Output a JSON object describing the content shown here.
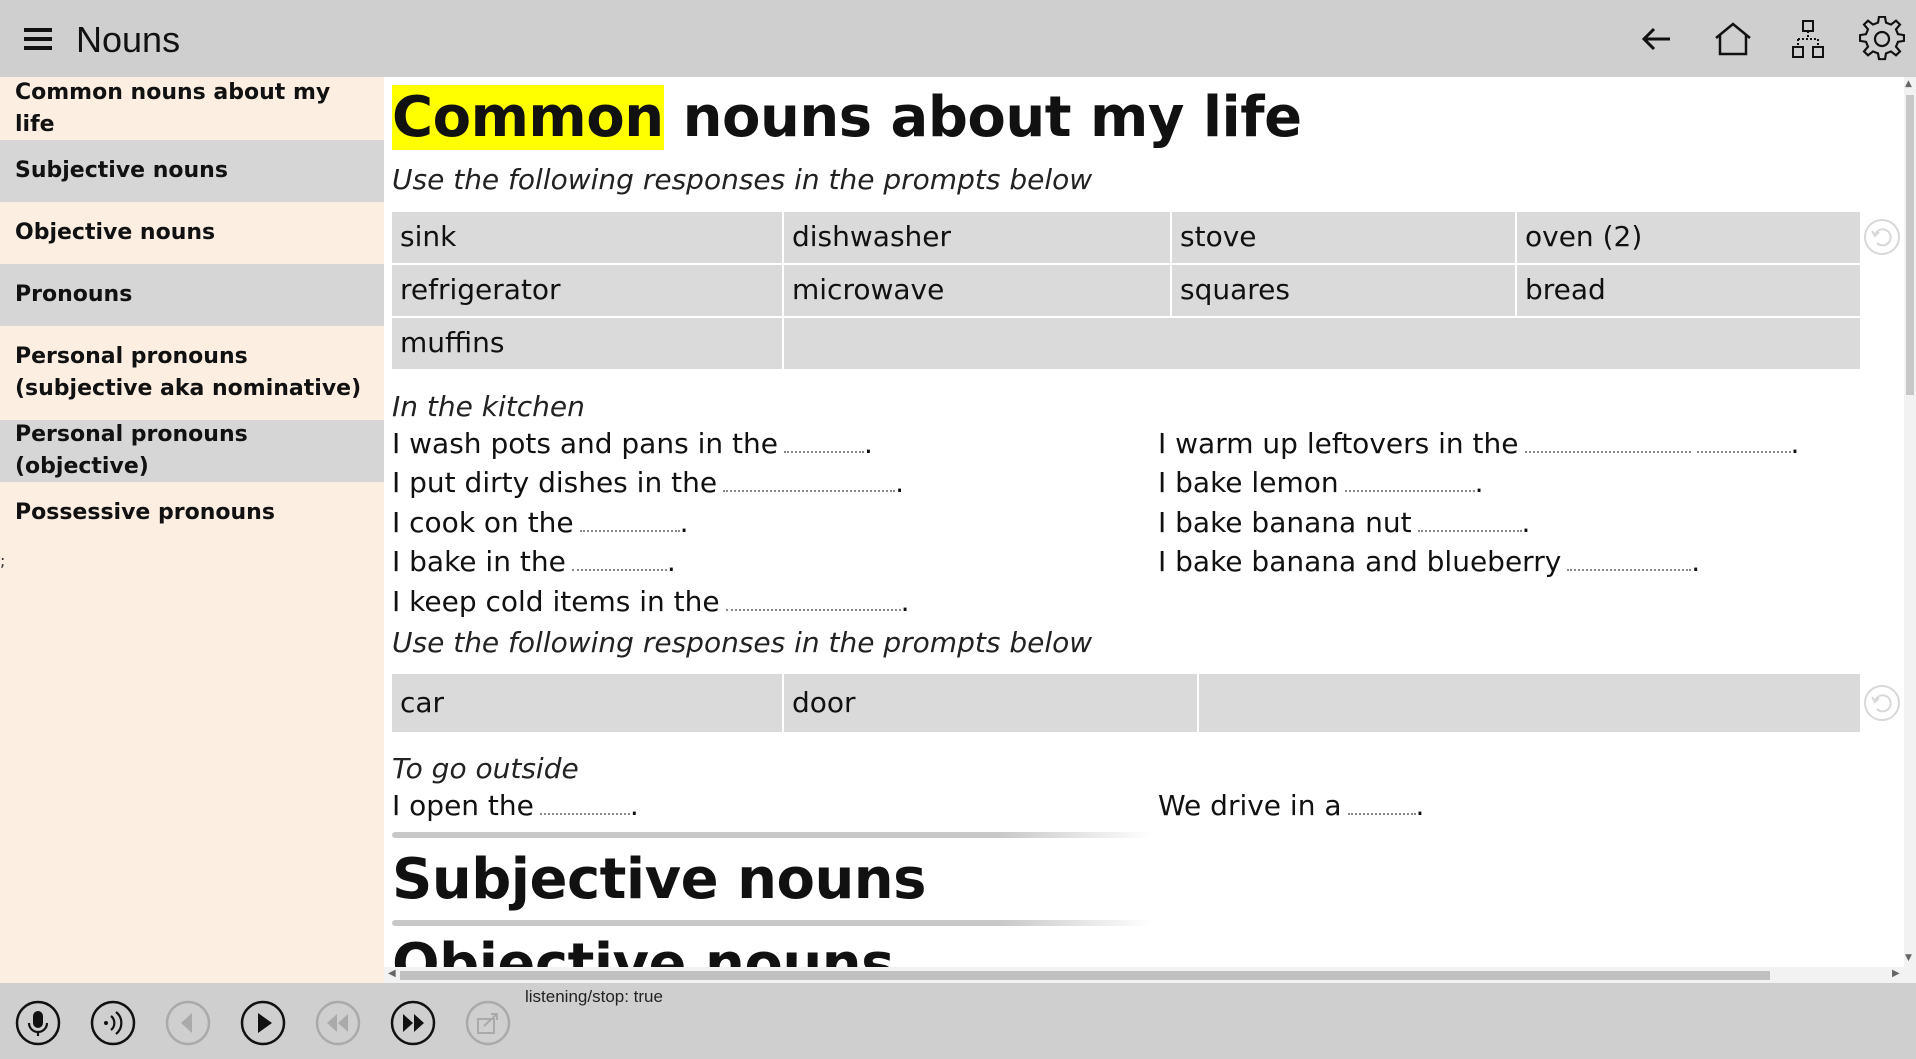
{
  "header": {
    "title": "Nouns",
    "icons": [
      "menu-icon",
      "back-arrow-icon",
      "home-icon",
      "sitemap-icon",
      "gear-icon"
    ]
  },
  "sidebar": {
    "items": [
      {
        "label": "Common nouns about my life"
      },
      {
        "label": "Subjective nouns"
      },
      {
        "label": "Objective nouns"
      },
      {
        "label": "Pronouns"
      },
      {
        "label": "Personal pronouns (subjective aka nominative)"
      },
      {
        "label": "Personal pronouns (objective)"
      },
      {
        "label": "Possessive pronouns"
      }
    ],
    "stray_mark": ";"
  },
  "main": {
    "section1": {
      "title_highlight": "Common",
      "title_rest": " nouns about my life",
      "instruction": "Use the following responses in the prompts below",
      "words": {
        "row1": [
          "sink",
          "dishwasher",
          "stove",
          "oven (2)"
        ],
        "row2": [
          "refrigerator",
          "microwave",
          "squares",
          "bread"
        ],
        "row3": [
          "muffins"
        ]
      },
      "subheading": "In the kitchen",
      "prompts_left": [
        "I wash pots and pans in the",
        "I put dirty dishes in the",
        "I cook on the",
        "I bake in the",
        "I keep cold items in the"
      ],
      "prompts_right": [
        "I warm up leftovers in the",
        "I bake lemon",
        "I bake banana nut",
        "I bake banana and blueberry"
      ],
      "instruction2": "Use the following responses in the prompts below",
      "words2": [
        "car",
        "door"
      ],
      "subheading2": "To go outside",
      "prompt_left2": "I open the",
      "prompt_right2": "We drive in a"
    },
    "section2_title": "Subjective nouns",
    "section3_title": "Objective nouns"
  },
  "footer": {
    "status": "listening/stop: true",
    "buttons": [
      "microphone-icon",
      "speaker-icon",
      "previous-icon",
      "play-icon",
      "rewind-icon",
      "fast-forward-icon",
      "share-icon"
    ]
  }
}
